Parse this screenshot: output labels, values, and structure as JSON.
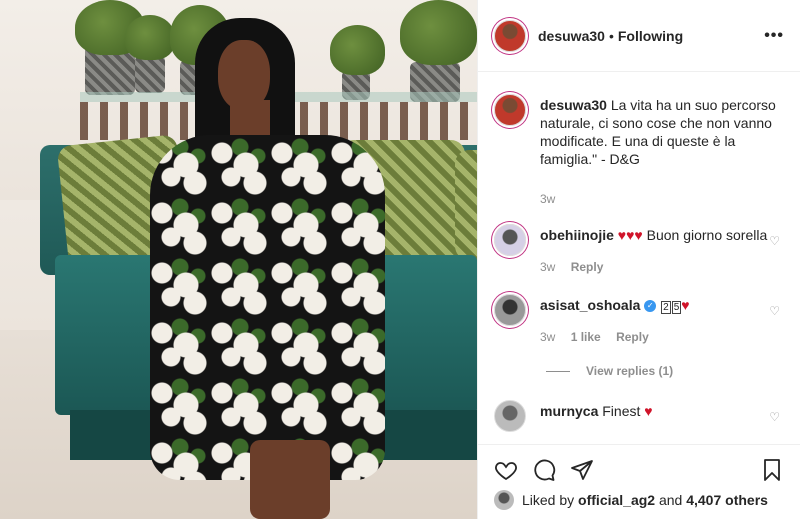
{
  "post": {
    "author": "desuwa30",
    "separator": "•",
    "follow_status": "Following",
    "more_label": "•••"
  },
  "caption": {
    "username": "desuwa30",
    "text": "La vita ha un suo percorso naturale, ci sono cose che non vanno modificate. E una di queste è la famiglia.\" - D&G",
    "time": "3w"
  },
  "comments": [
    {
      "username": "obehiinojie",
      "hearts": "♥♥♥",
      "text": "Buon giorno sorella",
      "time": "3w",
      "reply_label": "Reply"
    },
    {
      "username": "asisat_oshoala",
      "verified": "✓",
      "num1": "2",
      "num2": "5",
      "heart": "♥",
      "time": "3w",
      "likes_label": "1 like",
      "reply_label": "Reply",
      "view_replies": "View replies (1)"
    },
    {
      "username": "murnyca",
      "text": "Finest",
      "heart": "♥"
    }
  ],
  "likes": {
    "prefix": "Liked by",
    "user": "official_ag2",
    "and": "and",
    "others": "4,407 others"
  },
  "colors": {
    "heart_red": "#d0142a",
    "verified_blue": "#3897f0",
    "muted": "#8e8e8e"
  }
}
